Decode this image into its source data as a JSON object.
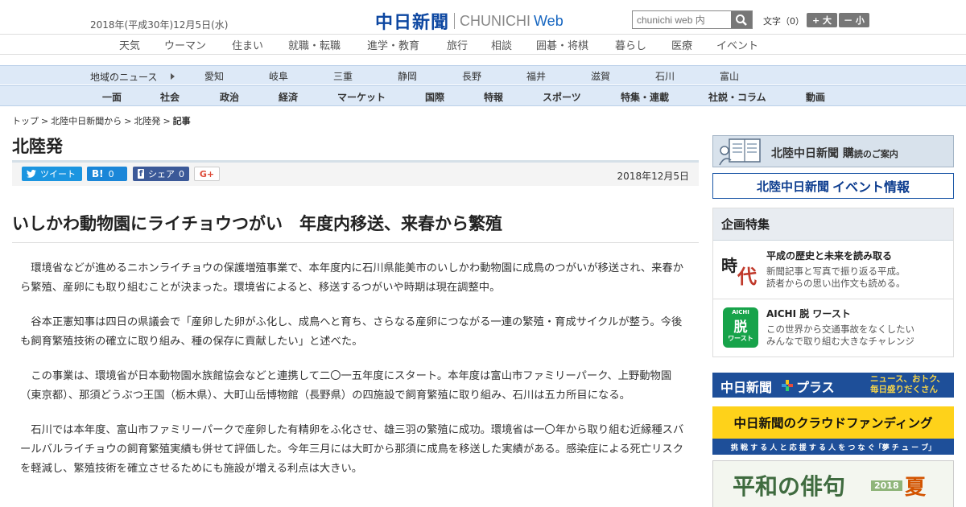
{
  "header": {
    "date": "2018年(平成30年)12月5日(水)",
    "logo_main": "中日新聞",
    "logo_sub": "CHUNICHI",
    "logo_web": "Web",
    "search_placeholder": "chunichi web 内",
    "font_size_label": "文字（0）",
    "font_increase": "+ 大",
    "font_decrease": "－ 小"
  },
  "category_nav": [
    "天気",
    "ウーマン",
    "住まい",
    "就職・転職",
    "進学・教育",
    "旅行",
    "相談",
    "囲碁・将棋",
    "暮らし",
    "医療",
    "イベント"
  ],
  "region_nav": {
    "label": "地域のニュース",
    "items": [
      "愛知",
      "岐阜",
      "三重",
      "静岡",
      "長野",
      "福井",
      "滋賀",
      "石川",
      "富山"
    ]
  },
  "genre_nav": [
    "一面",
    "社会",
    "政治",
    "経済",
    "マーケット",
    "国際",
    "特報",
    "スポーツ",
    "特集・連載",
    "社説・コラム",
    "動画"
  ],
  "breadcrumb": {
    "items": [
      "トップ",
      "北陸中日新聞から",
      "北陸発"
    ],
    "current": "記事",
    "separator": ">"
  },
  "section_title": "北陸発",
  "share": {
    "tweet": "ツイート",
    "hatena": "B!",
    "hatena_count": "0",
    "facebook": "シェア",
    "facebook_count": "0",
    "gplus": "G+",
    "date": "2018年12月5日"
  },
  "article": {
    "headline": "いしかわ動物園にライチョウつがい　年度内移送、来春から繁殖",
    "paragraphs": [
      "環境省などが進めるニホンライチョウの保護増殖事業で、本年度内に石川県能美市のいしかわ動物園に成鳥のつがいが移送され、来春から繁殖、産卵にも取り組むことが決まった。環境省によると、移送するつがいや時期は現在調整中。",
      "谷本正憲知事は四日の県議会で「産卵した卵がふ化し、成鳥へと育ち、さらなる産卵につながる一連の繁殖・育成サイクルが整う。今後も飼育繁殖技術の確立に取り組み、種の保存に貢献したい」と述べた。",
      "この事業は、環境省が日本動物園水族館協会などと連携して二〇一五年度にスタート。本年度は富山市ファミリーパーク、上野動物園（東京都）、那須どうぶつ王国（栃木県）、大町山岳博物館（長野県）の四施設で飼育繁殖に取り組み、石川は五カ所目になる。",
      "石川では本年度、富山市ファミリーパークで産卵した有精卵をふ化させ、雄三羽の繁殖に成功。環境省は一〇年から取り組む近縁種スバールバルライチョウの飼育繁殖実績も併せて評価した。今年三月には大町から那須に成鳥を移送した実績がある。感染症による死亡リスクを軽減し、繁殖技術を確立させるためにも施設が増える利点は大きい。"
    ]
  },
  "sidebar": {
    "subscribe": "北陸中日新聞 購",
    "subscribe_small": "読のご案内",
    "event_prefix": "北陸中日新聞",
    "event_main": "イベント情報",
    "kikaku_title": "企画特集",
    "kikaku_items": [
      {
        "thumb_text_1": "時",
        "thumb_text_2": "代",
        "title": "平成の歴史と未来を読み取る",
        "desc_1": "新聞記事と写真で振り返る平成。",
        "desc_2": "読者からの思い出作文も読める。"
      },
      {
        "thumb_text_top": "AICHI",
        "thumb_text_1": "脱",
        "thumb_text_2": "ワースト",
        "title": "AICHI 脱 ワースト",
        "desc_1": "この世界から交通事故をなくしたい",
        "desc_2": "みんなで取り組む大きなチャレンジ"
      }
    ],
    "plus_main": "中日新聞",
    "plus_word": "プラス",
    "plus_tag_1": "ニュース、おトク、",
    "plus_tag_2": "毎日盛りだくさん",
    "crowd_title": "中日新聞のクラウドファンディング",
    "crowd_sub": "挑 戦 す る 人 と 応 援 す る 人 を つ な ぐ「夢 チ ュ ー ブ」",
    "haiku_title": "平和の俳句",
    "haiku_year": "2018",
    "haiku_season": "夏"
  },
  "colors": {
    "brand_blue": "#0d47a1",
    "twitter": "#1b95e0",
    "hatena": "#1a86d8",
    "facebook": "#3b5998",
    "nav_bg": "#dde9f7"
  }
}
